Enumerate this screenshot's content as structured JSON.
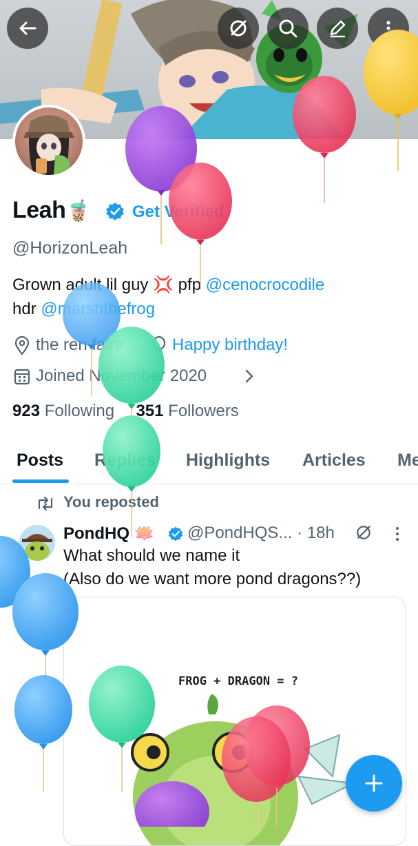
{
  "profile": {
    "name": "Leah",
    "name_emoji": "🧋",
    "get_verified": "Get Verified",
    "handle": "@HorizonLeah",
    "bio_line1_prefix": "Grown adult lil guy",
    "bio_emoji": "💢",
    "bio_line1_mid": "pfp",
    "bio_mention1": "@cenocrocodile",
    "bio_line2_prefix": "hdr",
    "bio_mention2": "@marshthefrog",
    "location": "the ren faire",
    "birthday": "Happy birthday!",
    "joined": "Joined November 2020",
    "following_count": "923",
    "following_label": "Following",
    "followers_count": "351",
    "followers_label": "Followers"
  },
  "tabs": [
    {
      "label": "Posts",
      "active": true
    },
    {
      "label": "Replies",
      "active": false
    },
    {
      "label": "Highlights",
      "active": false
    },
    {
      "label": "Articles",
      "active": false
    },
    {
      "label": "Me",
      "active": false
    }
  ],
  "post": {
    "repost_label": "You reposted",
    "author": "PondHQ",
    "author_emoji": "🪷",
    "handle_time": "@PondHQS... · 18h",
    "text_line1": "What should we name it",
    "text_line2": "(Also do we want more pond dragons??)",
    "media_caption": "FROG + DRAGON = ?"
  },
  "colors": {
    "accent": "#1d9bf0",
    "text_primary": "#0f1419",
    "text_secondary": "#536471"
  },
  "icons": [
    "back-arrow-icon",
    "grok-icon",
    "search-icon",
    "edit-icon",
    "more-vertical-icon",
    "verified-badge-icon",
    "location-pin-icon",
    "balloon-icon",
    "calendar-icon",
    "chevron-right-icon",
    "repost-icon",
    "more-horizontal-icon",
    "plus-icon"
  ]
}
